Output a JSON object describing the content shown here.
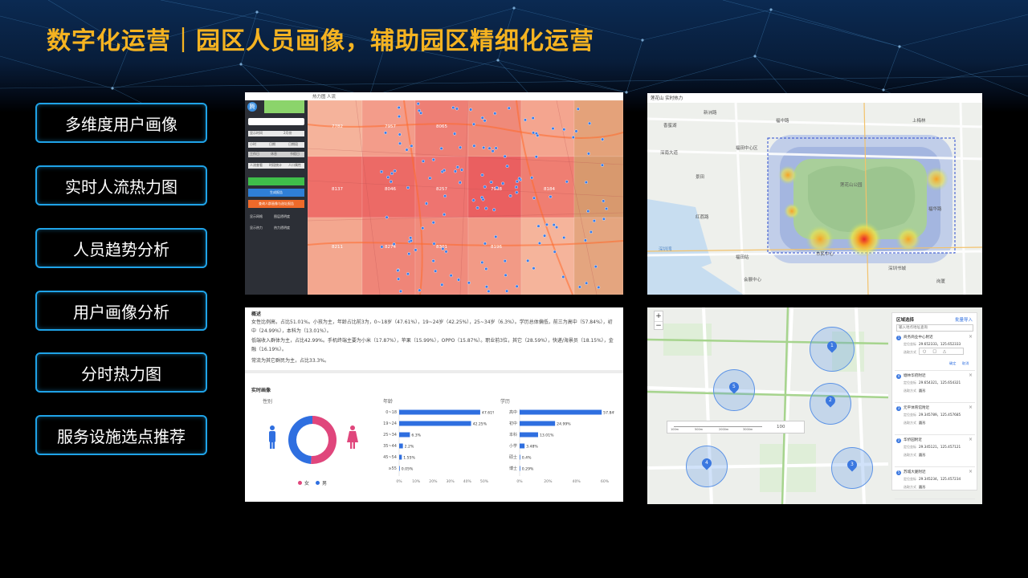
{
  "title": "数字化运营｜园区人员画像，辅助园区精细化运营",
  "menu": [
    "多维度用户画像",
    "实时人流热力图",
    "人员趋势分析",
    "用户画像分析",
    "分时热力图",
    "服务设施选点推荐"
  ],
  "colors": {
    "title": "#f5b321",
    "menu_border": "#1fa3e8",
    "female": "#e0467c",
    "male": "#2f6fe0"
  },
  "heatmap_app": {
    "logo": "腾",
    "tabs": [
      "热力图",
      "人流"
    ],
    "controls": [
      "显示时间",
      "2月份",
      "小时",
      "日期",
      "日期段",
      "工作日",
      "休息",
      "节假日",
      "人流查看",
      "时段统计",
      "人口属性"
    ],
    "buttons": [
      "",
      "生成报告",
      "查询人群画像与选址报告"
    ],
    "legend": [
      "显示网格",
      "图层透明度",
      "显示热力",
      "热力透明度"
    ],
    "grid_values": [
      "7782",
      "7957",
      "8065",
      "8137",
      "8046",
      "8257",
      "7938",
      "8184",
      "8211",
      "8274",
      "8301",
      "8196"
    ]
  },
  "live_heat": {
    "header": "莲花山 实时热力",
    "labels": [
      "香蜜湖",
      "福田中心区",
      "莲花山公园",
      "深圳书城",
      "市民中心",
      "福田站",
      "深圳湾",
      "会展中心",
      "上梅林",
      "景田",
      "岗厦",
      "深南大道",
      "福华路",
      "福中路",
      "红荔路",
      "新洲路"
    ]
  },
  "summary": {
    "header": "概述",
    "lines": [
      "女性比例高，占比51.01%。小孩为主，年龄占比前3为，0~18岁（47.61%），19~24岁（42.25%），25~34岁（6.3%）。学历总体偏低，前三为高中（57.84%），初中（24.99%），本科为（13.01%）。",
      "低端收入群体为主，占比42.99%。手机终端主要为小米（17.87%），苹果（15.99%），OPPO（15.87%）。职业前3位，其它（28.59%），快递/海景员（18.15%），金融（16.19%）。",
      "常流为其它群民为主，占比33.3%。"
    ],
    "section": "实时画像",
    "gender_title": "性别",
    "age_title": "年龄",
    "edu_title": "学历",
    "gender_legend": [
      "女",
      "男"
    ]
  },
  "chart_data": [
    {
      "type": "pie",
      "title": "性别",
      "categories": [
        "女",
        "男"
      ],
      "values": [
        51.01,
        48.99
      ]
    },
    {
      "type": "bar",
      "title": "年龄",
      "categories": [
        "0~18",
        "19~24",
        "25~34",
        "35~44",
        "45~54",
        "≥55"
      ],
      "values": [
        47.61,
        42.25,
        6.3,
        2.2,
        1.55,
        0.05
      ],
      "data_labels": [
        "47.61%",
        "42.25%",
        "6.3%",
        "2.2%",
        "1.55%",
        "0.05%"
      ],
      "xticks": [
        "0%",
        "10%",
        "20%",
        "30%",
        "40%",
        "50%"
      ],
      "xlim": [
        0,
        50
      ]
    },
    {
      "type": "bar",
      "title": "学历",
      "categories": [
        "高中",
        "初中",
        "本科",
        "小学",
        "硕士",
        "博士"
      ],
      "values": [
        57.84,
        24.99,
        13.01,
        3.48,
        0.4,
        0.29
      ],
      "data_labels": [
        "57.84%",
        "24.99%",
        "13.01%",
        "3.48%",
        "0.4%",
        "0.29%"
      ],
      "xticks": [
        "0%",
        "20%",
        "40%",
        "60%"
      ],
      "xlim": [
        0,
        60
      ]
    }
  ],
  "site_select": {
    "panel_title": "区域选择",
    "panel_action": "批量导入",
    "search_placeholder": "输入地点地址查询",
    "scale": [
      "100m",
      "500m",
      "2000m",
      "3000m"
    ],
    "radius": "100",
    "markers": [
      "1",
      "2",
      "3",
      "4",
      "5"
    ],
    "items": [
      {
        "no": "1",
        "name": "商务商业中心附近",
        "coord_label": "定位坐标",
        "coord": "29.652333，125.652333",
        "mode_label": "选取方式",
        "confirm": "确定",
        "cancel": "取消"
      },
      {
        "no": "4",
        "name": "塘林华府附近",
        "coord_label": "定位坐标",
        "coord": "29.654321，125.654321",
        "mode_label": "选取方式",
        "mode": "圆形"
      },
      {
        "no": "3",
        "name": "元平体育馆附近",
        "coord_label": "定位坐标",
        "coord": "29.345789，125.457685",
        "mode_label": "选取方式",
        "mode": "圆形"
      },
      {
        "no": "2",
        "name": "华侨园附近",
        "coord_label": "定位坐标",
        "coord": "29.345121，125.457121",
        "mode_label": "选取方式",
        "mode": "圆形"
      },
      {
        "no": "5",
        "name": "苏城大厦附近",
        "coord_label": "定位坐标",
        "coord": "29.345234，125.457234",
        "mode_label": "选取方式",
        "mode": "圆形"
      }
    ],
    "zoom_in": "+",
    "zoom_out": "−"
  }
}
